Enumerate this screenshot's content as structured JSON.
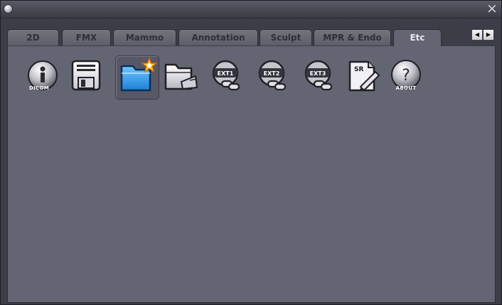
{
  "window": {
    "close_glyph": "×"
  },
  "tabs": [
    {
      "label": "2D",
      "active": false
    },
    {
      "label": "FMX",
      "active": false
    },
    {
      "label": "Mammo",
      "active": false
    },
    {
      "label": "Annotation",
      "active": false
    },
    {
      "label": "Sculpt",
      "active": false
    },
    {
      "label": "MPR & Endo",
      "active": false
    },
    {
      "label": "Etc",
      "active": true
    }
  ],
  "tab_scroll": {
    "left_glyph": "◀",
    "right_glyph": "▶"
  },
  "tools": [
    {
      "id": "dicom-info",
      "icon": "info-icon",
      "badge": "DICOM"
    },
    {
      "id": "save",
      "icon": "floppy-disk-icon",
      "badge": ""
    },
    {
      "id": "new-folder",
      "icon": "new-folder-icon",
      "badge": "",
      "selected": true
    },
    {
      "id": "open-folder",
      "icon": "open-folder-icon",
      "badge": ""
    },
    {
      "id": "ext1",
      "icon": "ext-link-icon",
      "badge": "EXT1"
    },
    {
      "id": "ext2",
      "icon": "ext-link-icon",
      "badge": "EXT2"
    },
    {
      "id": "ext3",
      "icon": "ext-link-icon",
      "badge": "EXT3"
    },
    {
      "id": "structured-report",
      "icon": "sr-document-icon",
      "badge": "SR"
    },
    {
      "id": "about",
      "icon": "help-icon",
      "badge": "ABOUT"
    }
  ],
  "colors": {
    "panel": "#646573",
    "frame": "#3d3d48",
    "tab_inactive": "#6a6a75",
    "tab_active": "#646573"
  }
}
